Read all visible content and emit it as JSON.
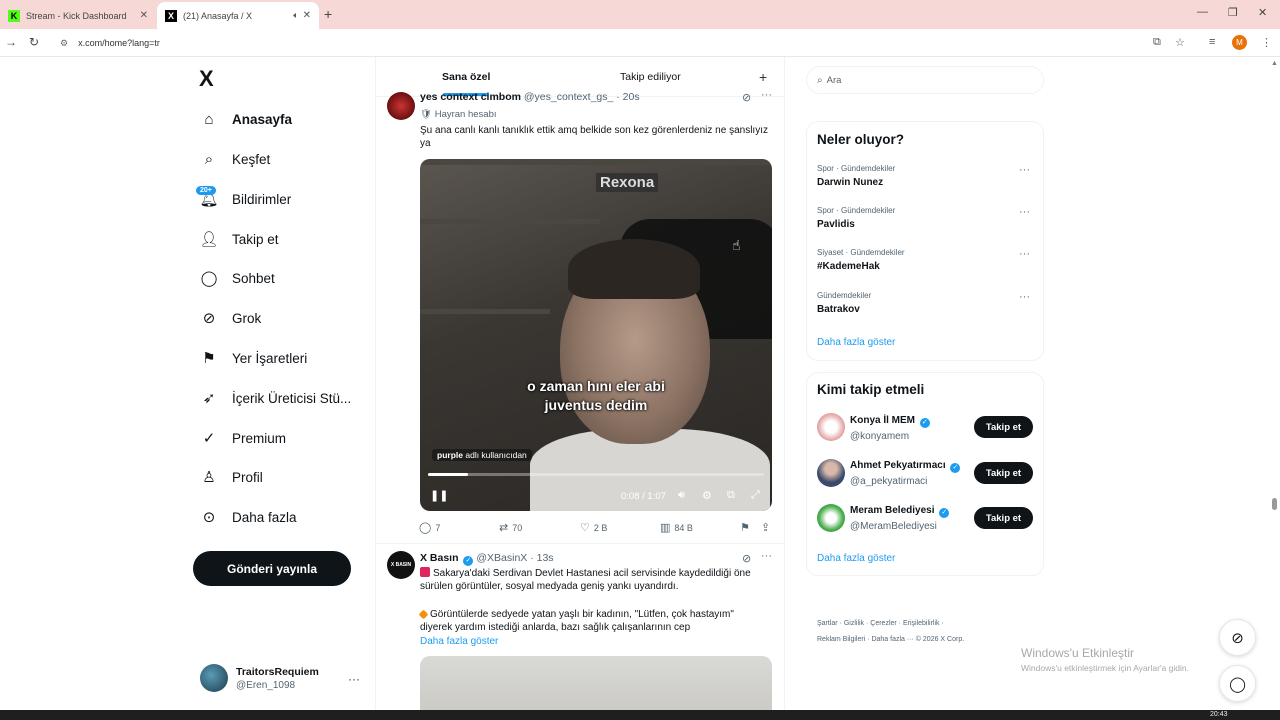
{
  "browser": {
    "tabs": [
      {
        "title": "Stream - Kick Dashboard",
        "favicon": "K"
      },
      {
        "title": "(21) Anasayfa / X",
        "favicon": "X"
      }
    ],
    "url": "x.com/home?lang=tr",
    "profile_initial": "M"
  },
  "nav": {
    "logo": "X",
    "items": [
      {
        "label": "Anasayfa"
      },
      {
        "label": "Keşfet"
      },
      {
        "label": "Bildirimler"
      },
      {
        "label": "Takip et"
      },
      {
        "label": "Sohbet"
      },
      {
        "label": "Grok"
      },
      {
        "label": "Yer İşaretleri"
      },
      {
        "label": "İçerik Üreticisi Stü..."
      },
      {
        "label": "Premium"
      },
      {
        "label": "Profil"
      },
      {
        "label": "Daha fazla"
      }
    ],
    "notification_badge": "20+",
    "post_button": "Gönderi yayınla",
    "user": {
      "name": "TraitorsRequiem",
      "handle": "@Eren_1098"
    }
  },
  "feed": {
    "tabs": [
      "Sana özel",
      "Takip ediliyor"
    ],
    "tweet1": {
      "name": "yes context cimbom",
      "handle": "@yes_context_gs_ · 20s",
      "badge_label": "Hayran hesabı",
      "text": "Şu ana canlı kanlı tanıklık ettik amq belkide son kez görenlerdeniz ne şanslıyız ya",
      "video": {
        "rexona": "Rexona",
        "subtitle_line1": "o zaman hını eler abi",
        "subtitle_line2": "juventus dedim",
        "watermark_user": "purple",
        "watermark_suffix": "adlı kullanıcıdan",
        "time": "0:08 / 1:07",
        "progress": 0.12
      },
      "stats": {
        "replies": "7",
        "retweets": "70",
        "likes": "2 B",
        "views": "84 B"
      }
    },
    "tweet2": {
      "name": "X Basın",
      "handle": "@XBasinX · 13s",
      "avatar_text": "X BASIN",
      "line1": "Sakarya'daki Serdivan Devlet Hastanesi acil servisinde kaydedildiği öne sürülen görüntüler, sosyal medyada geniş yankı uyandırdı.",
      "line2": "Görüntülerde sedyede yatan yaşlı bir kadının, \"Lütfen, çok hastayım\" diyerek yardım istediği anlarda, bazı sağlık çalışanlarının cep",
      "show_more": "Daha fazla göster"
    }
  },
  "right": {
    "search_placeholder": "Ara",
    "trends_title": "Neler oluyor?",
    "trends": [
      {
        "meta": "Spor · Gündemdekiler",
        "name": "Darwin Nunez"
      },
      {
        "meta": "Spor · Gündemdekiler",
        "name": "Pavlidis"
      },
      {
        "meta": "Siyaset · Gündemdekiler",
        "name": "#KademeHak"
      },
      {
        "meta": "Gündemdekiler",
        "name": "Batrakov"
      }
    ],
    "trends_more": "Daha fazla göster",
    "who_title": "Kimi takip etmeli",
    "who": [
      {
        "name": "Konya İl MEM",
        "handle": "@konyamem"
      },
      {
        "name": "Ahmet Pekyatırmacı",
        "handle": "@a_pekyatirmaci"
      },
      {
        "name": "Meram Belediyesi",
        "handle": "@MeramBelediyesi"
      }
    ],
    "follow_label": "Takip et",
    "who_more": "Daha fazla göster",
    "footer1": "Şartlar  ·  Gizlilik  ·  Çerezler  ·  Erişilebilirlik  ·",
    "footer2": "Reklam Bilgileri  ·  Daha fazla ···  © 2026 X Corp."
  },
  "windows": {
    "activate_title": "Windows'u Etkinleştir",
    "activate_sub": "Windows'u etkinleştirmek için Ayarlar'a gidin.",
    "clock": "20:43"
  },
  "colors": {
    "accent": "#1d9bf0",
    "text": "#0f1419",
    "muted": "#536471"
  }
}
